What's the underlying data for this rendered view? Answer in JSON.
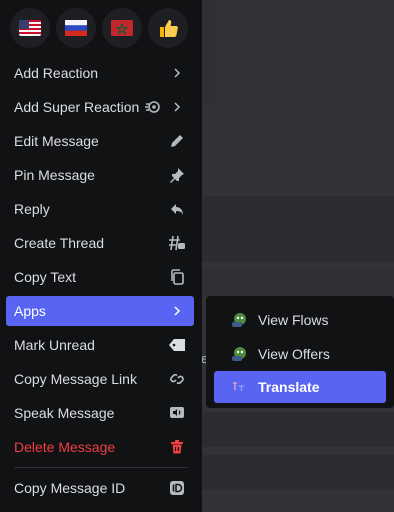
{
  "reactions": [
    {
      "name": "us-flag-emoji"
    },
    {
      "name": "russia-flag-emoji"
    },
    {
      "name": "morocco-flag-emoji"
    },
    {
      "name": "thumbs-up-emoji"
    }
  ],
  "menu": {
    "add_reaction": "Add Reaction",
    "add_super_reaction": "Add Super Reaction",
    "edit_message": "Edit Message",
    "pin_message": "Pin Message",
    "reply": "Reply",
    "create_thread": "Create Thread",
    "copy_text": "Copy Text",
    "apps": "Apps",
    "mark_unread": "Mark Unread",
    "copy_message_link": "Copy Message Link",
    "speak_message": "Speak Message",
    "delete_message": "Delete Message",
    "copy_message_id": "Copy Message ID"
  },
  "submenu": {
    "view_flows": "View Flows",
    "view_offers": "View Offers",
    "translate": "Translate"
  },
  "stray_text": "e",
  "colors": {
    "menu_bg": "#111214",
    "active": "#5865f2",
    "danger": "#f23f42",
    "text": "#dbdee1",
    "background": "#313338"
  },
  "icons": {
    "chevron": "chevron-right-icon",
    "super_reaction": "super-reaction-icon",
    "edit": "pencil-icon",
    "pin": "pin-icon",
    "reply": "reply-arrow-icon",
    "thread": "thread-icon",
    "copy": "copy-icon",
    "mark_unread": "tag-icon",
    "link": "link-icon",
    "speak": "speaker-icon",
    "delete": "trash-icon",
    "id": "id-badge-icon"
  }
}
